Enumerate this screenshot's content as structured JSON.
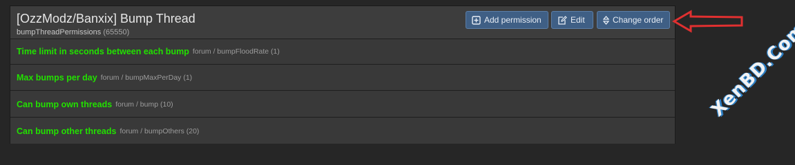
{
  "header": {
    "title": "[OzzModz/Banxix] Bump Thread",
    "subtitle_key": "bumpThreadPermissions",
    "subtitle_id": "(65550)"
  },
  "buttons": {
    "add_permission": "Add permission",
    "edit": "Edit",
    "change_order": "Change order"
  },
  "rows": [
    {
      "name": "Time limit in seconds between each bump",
      "key": "forum / bumpFloodRate (1)"
    },
    {
      "name": "Max bumps per day",
      "key": "forum / bumpMaxPerDay (1)"
    },
    {
      "name": "Can bump own threads",
      "key": "forum / bump (10)"
    },
    {
      "name": "Can bump other threads",
      "key": "forum / bumpOthers (20)"
    }
  ],
  "watermark": "XenBD.Com",
  "colors": {
    "accent_button": "#3f5f85",
    "permission_name": "#22e000",
    "arrow": "#e03030"
  }
}
